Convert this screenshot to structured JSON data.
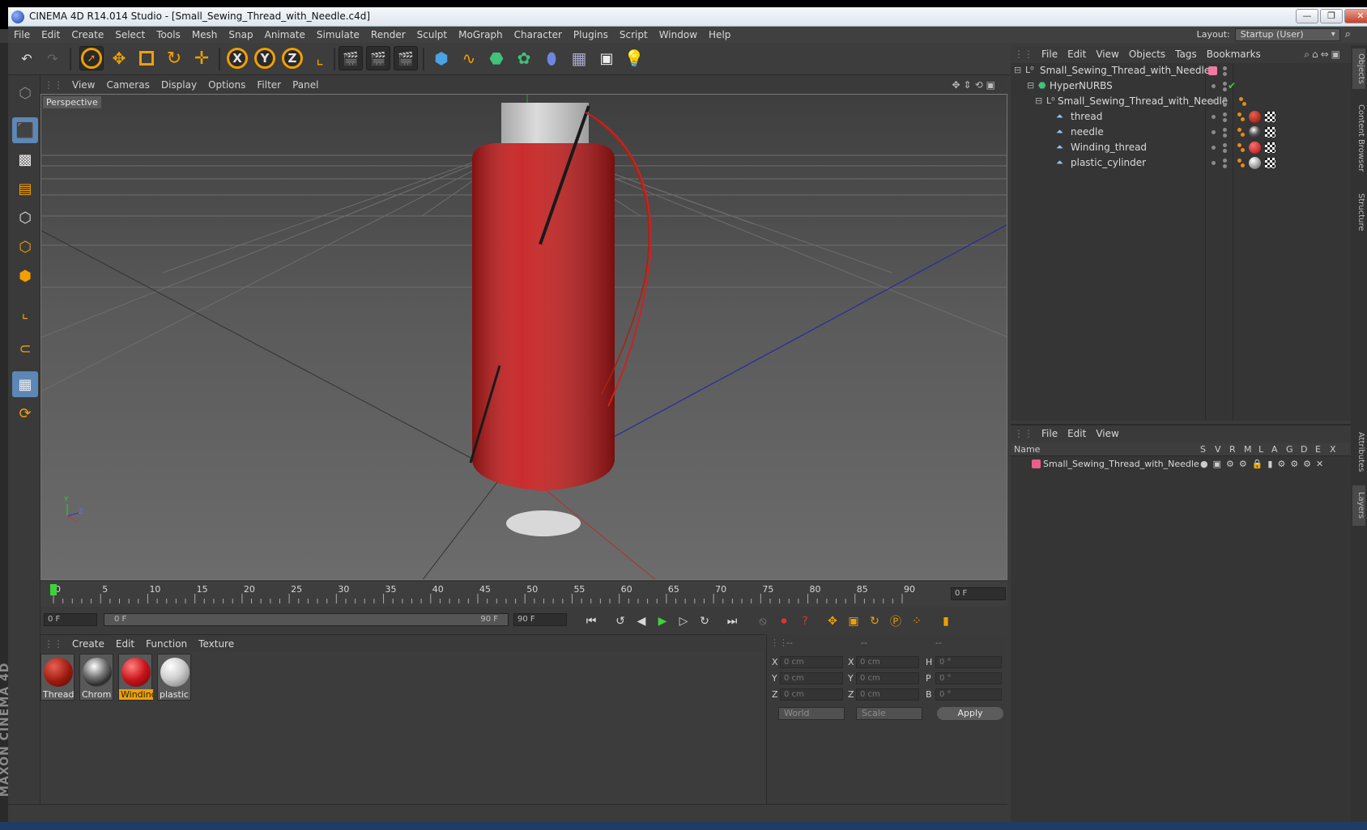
{
  "window": {
    "title": "CINEMA 4D R14.014 Studio - [Small_Sewing_Thread_with_Needle.c4d]",
    "minimize": "—",
    "restore": "❐",
    "close": "✕"
  },
  "menubar": {
    "items": [
      "File",
      "Edit",
      "Create",
      "Select",
      "Tools",
      "Mesh",
      "Snap",
      "Animate",
      "Simulate",
      "Render",
      "Sculpt",
      "MoGraph",
      "Character",
      "Plugins",
      "Script",
      "Window",
      "Help"
    ],
    "layout_label": "Layout:",
    "layout_value": "Startup (User)"
  },
  "viewport": {
    "menu": [
      "View",
      "Cameras",
      "Display",
      "Options",
      "Filter",
      "Panel"
    ],
    "label": "Perspective",
    "axis_y": "Y",
    "axis_z": "Z"
  },
  "timeline": {
    "ticks": [
      "0",
      "5",
      "10",
      "15",
      "20",
      "25",
      "30",
      "35",
      "40",
      "45",
      "50",
      "55",
      "60",
      "65",
      "70",
      "75",
      "80",
      "85",
      "90"
    ],
    "frame_readout": "0 F",
    "start_field": "0 F",
    "range_start": "0 F",
    "range_end": "90 F",
    "end_field": "90 F"
  },
  "materials": {
    "menu": [
      "Create",
      "Edit",
      "Function",
      "Texture"
    ],
    "items": [
      {
        "name": "Thread",
        "color": "#b01a10"
      },
      {
        "name": "Chrom",
        "color": "#7a7a7a"
      },
      {
        "name": "Windinç",
        "color": "#c8141a"
      },
      {
        "name": "plastic",
        "color": "#d6d6d6"
      }
    ]
  },
  "coordinates": {
    "headers": [
      "--",
      "--",
      "--"
    ],
    "rows": [
      {
        "a": "X",
        "av": "0 cm",
        "b": "X",
        "bv": "0 cm",
        "c": "H",
        "cv": "0 °"
      },
      {
        "a": "Y",
        "av": "0 cm",
        "b": "Y",
        "bv": "0 cm",
        "c": "P",
        "cv": "0 °"
      },
      {
        "a": "Z",
        "av": "0 cm",
        "b": "Z",
        "bv": "0 cm",
        "c": "B",
        "cv": "0 °"
      }
    ],
    "world": "World",
    "scale": "Scale",
    "apply": "Apply"
  },
  "objects": {
    "menu": [
      "File",
      "Edit",
      "View",
      "Objects",
      "Tags",
      "Bookmarks"
    ],
    "rows": [
      {
        "name": "Small_Sewing_Thread_with_Needle",
        "type": "null",
        "tag": "pink"
      },
      {
        "name": "HyperNURBS",
        "type": "nurbs",
        "tag": "check"
      },
      {
        "name": "Small_Sewing_Thread_with_Needle",
        "type": "null",
        "tag": "none"
      },
      {
        "name": "thread",
        "type": "poly",
        "tag": "red"
      },
      {
        "name": "needle",
        "type": "poly",
        "tag": "chrome"
      },
      {
        "name": "Winding_thread",
        "type": "poly",
        "tag": "red"
      },
      {
        "name": "plastic_cylinder",
        "type": "poly",
        "tag": "grey"
      }
    ]
  },
  "layers": {
    "menu": [
      "File",
      "Edit",
      "View"
    ],
    "columns": [
      "Name",
      "S",
      "V",
      "R",
      "M",
      "L",
      "A",
      "G",
      "D",
      "E",
      "X"
    ],
    "rows": [
      {
        "name": "Small_Sewing_Thread_with_Needle",
        "color": "#e8608a"
      }
    ]
  },
  "right_tabs": [
    "Objects",
    "Content Browser",
    "Structure",
    "Attributes",
    "Layers"
  ],
  "brand": {
    "text": "MAXON CINEMA 4D"
  },
  "colors": {
    "accent": "#f1a000",
    "selection": "#5d87b6"
  }
}
